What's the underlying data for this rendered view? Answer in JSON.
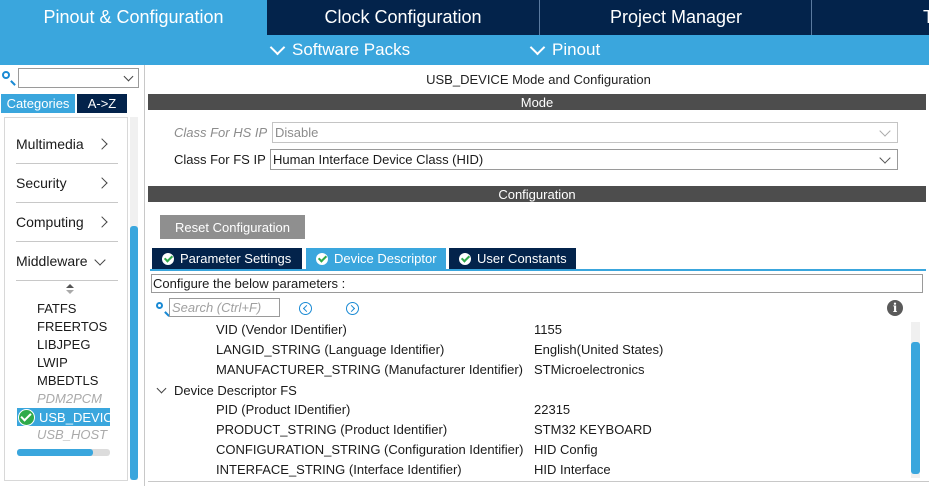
{
  "top_tabs": [
    {
      "label": "Pinout & Configuration",
      "active": true
    },
    {
      "label": "Clock Configuration",
      "active": false
    },
    {
      "label": "Project Manager",
      "active": false
    },
    {
      "label": "T",
      "active": false
    }
  ],
  "sub_bar": {
    "software_packs": "Software Packs",
    "pinout": "Pinout"
  },
  "left_panel": {
    "search_value": "",
    "categories_label": "Categories",
    "az_label": "A->Z",
    "categories": [
      "Multimedia",
      "Security",
      "Computing",
      "Middleware"
    ],
    "middleware_items": [
      {
        "label": "FATFS",
        "enabled": true
      },
      {
        "label": "FREERTOS",
        "enabled": true
      },
      {
        "label": "LIBJPEG",
        "enabled": true
      },
      {
        "label": "LWIP",
        "enabled": true
      },
      {
        "label": "MBEDTLS",
        "enabled": true
      },
      {
        "label": "PDM2PCM",
        "enabled": false
      }
    ],
    "selected_item": "USB_DEVICE",
    "after_selected": {
      "label": "USB_HOST",
      "enabled": false
    }
  },
  "main": {
    "title": "USB_DEVICE Mode and Configuration",
    "mode_header": "Mode",
    "hs_label": "Class For HS IP",
    "hs_value": "Disable",
    "fs_label": "Class For FS IP",
    "fs_value": "Human Interface Device Class (HID)",
    "config_header": "Configuration",
    "reset_label": "Reset Configuration",
    "tabs": [
      {
        "label": "Parameter Settings",
        "active": false
      },
      {
        "label": "Device Descriptor",
        "active": true
      },
      {
        "label": "User Constants",
        "active": false
      }
    ],
    "configure_text": "Configure the below parameters :",
    "search_placeholder": "Search (Ctrl+F)",
    "info_glyph": "i",
    "params_top": [
      {
        "name": "VID (Vendor IDentifier)",
        "value": "1155"
      },
      {
        "name": "LANGID_STRING (Language Identifier)",
        "value": "English(United States)"
      },
      {
        "name": "MANUFACTURER_STRING (Manufacturer Identifier)",
        "value": "STMicroelectronics"
      }
    ],
    "group_label": "Device Descriptor FS",
    "params_fs": [
      {
        "name": "PID (Product IDentifier)",
        "value": "22315"
      },
      {
        "name": "PRODUCT_STRING (Product Identifier)",
        "value": "STM32 KEYBOARD"
      },
      {
        "name": "CONFIGURATION_STRING (Configuration Identifier)",
        "value": "HID Config"
      },
      {
        "name": "INTERFACE_STRING (Interface Identifier)",
        "value": "HID Interface"
      }
    ]
  },
  "colors": {
    "navy": "#03234b",
    "accent_blue": "#3aa6dd",
    "header_gray": "#4d4d4d",
    "check_green": "#2faa4a"
  }
}
